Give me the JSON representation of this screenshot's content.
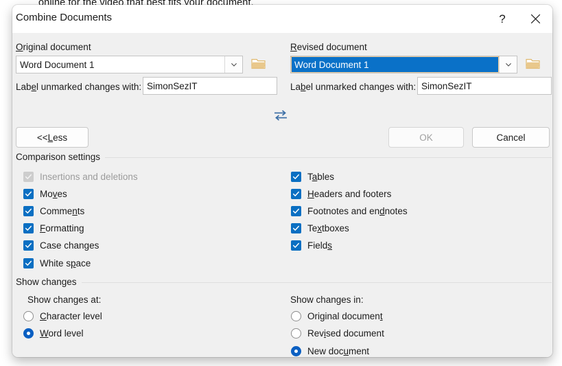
{
  "background": {
    "document_text": "online for the video that best fits your document."
  },
  "dialog": {
    "title": "Combine Documents",
    "titlebar": {
      "help_label": "?",
      "help_icon": "question-mark-icon",
      "close_icon": "close-icon"
    },
    "original": {
      "label": "Original document",
      "label_accel": "O",
      "combo_value": "Word Document 1",
      "dropdown_icon": "chevron-down-icon",
      "browse_icon": "open-folder-icon",
      "unmarked_label": "Label unmarked changes with:",
      "unmarked_accel": "e",
      "unmarked_value": "SimonSezIT"
    },
    "revised": {
      "label": "Revised document",
      "label_accel": "R",
      "combo_value": "Word Document 1",
      "combo_focused": true,
      "dropdown_icon": "chevron-down-icon",
      "browse_icon": "open-folder-icon",
      "unmarked_label": "Label unmarked changes with:",
      "unmarked_accel": "b",
      "unmarked_value": "SimonSezIT"
    },
    "swap_icon": "swap-documents-icon",
    "buttons": {
      "less": {
        "text_pre": "<< ",
        "accel": "L",
        "text_post": "ess",
        "enabled": true
      },
      "ok": {
        "label": "OK",
        "enabled": false
      },
      "cancel": {
        "label": "Cancel",
        "enabled": true
      }
    },
    "comparison_settings": {
      "group_label": "Comparison settings",
      "left_column": [
        {
          "label_pre": "Insertions and deletions",
          "accel": "",
          "label_post": "",
          "checked": true,
          "disabled": true
        },
        {
          "label_pre": "Mo",
          "accel": "v",
          "label_post": "es",
          "checked": true,
          "disabled": false
        },
        {
          "label_pre": "Comme",
          "accel": "n",
          "label_post": "ts",
          "checked": true,
          "disabled": false
        },
        {
          "label_pre": "",
          "accel": "F",
          "label_post": "ormatting",
          "checked": true,
          "disabled": false
        },
        {
          "label_pre": "Case chan",
          "accel": "g",
          "label_post": "es",
          "checked": true,
          "disabled": false
        },
        {
          "label_pre": "White s",
          "accel": "p",
          "label_post": "ace",
          "checked": true,
          "disabled": false
        }
      ],
      "right_column": [
        {
          "label_pre": "T",
          "accel": "a",
          "label_post": "bles",
          "checked": true,
          "disabled": false
        },
        {
          "label_pre": "",
          "accel": "H",
          "label_post": "eaders and footers",
          "checked": true,
          "disabled": false
        },
        {
          "label_pre": "Footnotes and en",
          "accel": "d",
          "label_post": "notes",
          "checked": true,
          "disabled": false
        },
        {
          "label_pre": "Te",
          "accel": "x",
          "label_post": "tboxes",
          "checked": true,
          "disabled": false
        },
        {
          "label_pre": "Field",
          "accel": "s",
          "label_post": "",
          "checked": true,
          "disabled": false
        }
      ]
    },
    "show_changes": {
      "group_label": "Show changes",
      "at": {
        "label": "Show changes at:",
        "options": [
          {
            "label_pre": "",
            "accel": "C",
            "label_post": "haracter level",
            "selected": false
          },
          {
            "label_pre": "",
            "accel": "W",
            "label_post": "ord level",
            "selected": true
          }
        ]
      },
      "in": {
        "label": "Show changes in:",
        "options": [
          {
            "label_pre": "Original documen",
            "accel": "t",
            "label_post": "",
            "selected": false
          },
          {
            "label_pre": "Rev",
            "accel": "i",
            "label_post": "sed document",
            "selected": false
          },
          {
            "label_pre": "New doc",
            "accel": "u",
            "label_post": "ment",
            "selected": true
          }
        ]
      }
    }
  },
  "colors": {
    "accent": "#0a6fc2",
    "selection": "#0a71c8",
    "dialog_bg": "#f0f0f0",
    "folder": "#e9c88c"
  }
}
